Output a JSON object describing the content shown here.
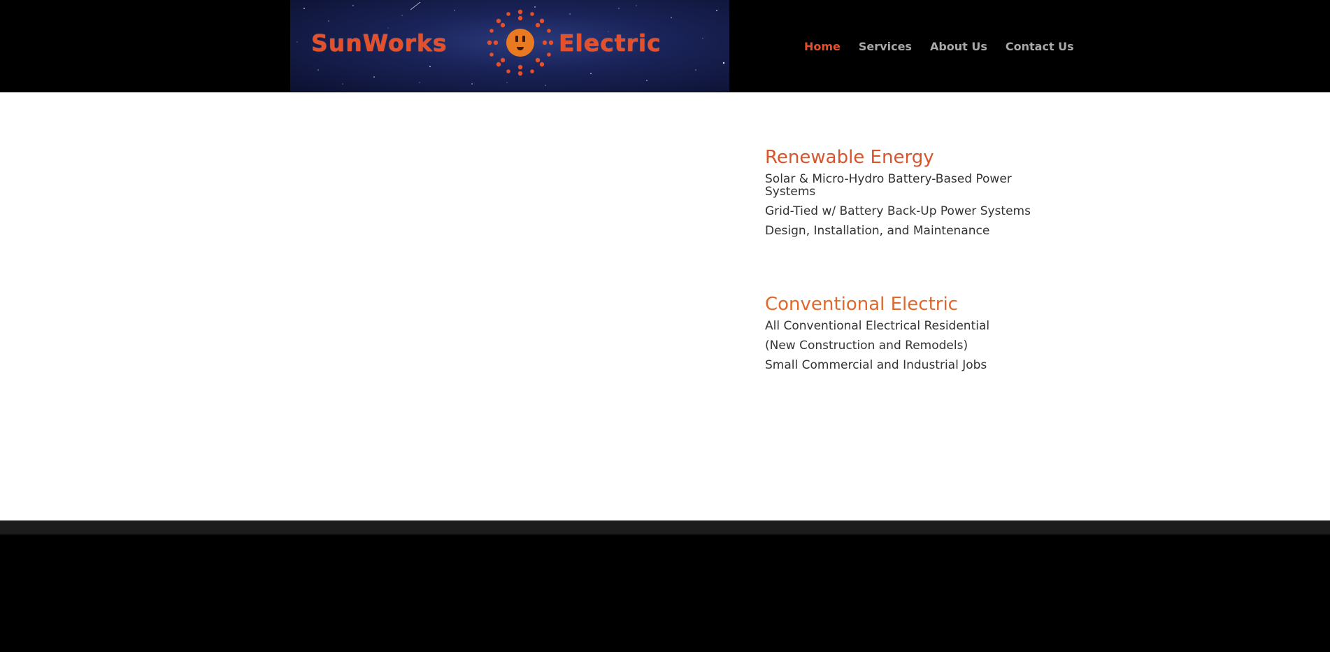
{
  "logo": {
    "left_word": "SunWorks",
    "right_word": "Electric",
    "icon": "sun-outlet-icon",
    "brand_color": "#e5502a"
  },
  "nav": {
    "items": [
      {
        "label": "Home",
        "active": true
      },
      {
        "label": "Services",
        "active": false
      },
      {
        "label": "About Us",
        "active": false
      },
      {
        "label": "Contact Us",
        "active": false
      }
    ]
  },
  "renewable": {
    "title": "Renewable Energy",
    "lines": [
      "Solar & Micro-Hydro Battery-Based Power Systems",
      "Grid-Tied w/ Battery Back-Up Power Systems",
      "Design, Installation, and Maintenance"
    ]
  },
  "conventional": {
    "title": "Conventional Electric",
    "lines": [
      "All Conventional Electrical Residential",
      "(New Construction and Remodels)",
      "Small Commercial and Industrial Jobs"
    ]
  },
  "colors": {
    "header_bg": "#000000",
    "accent": "#e5502a",
    "nav_text": "#a9a9a9",
    "body_text": "#333333",
    "footer_bg": "#000000"
  }
}
